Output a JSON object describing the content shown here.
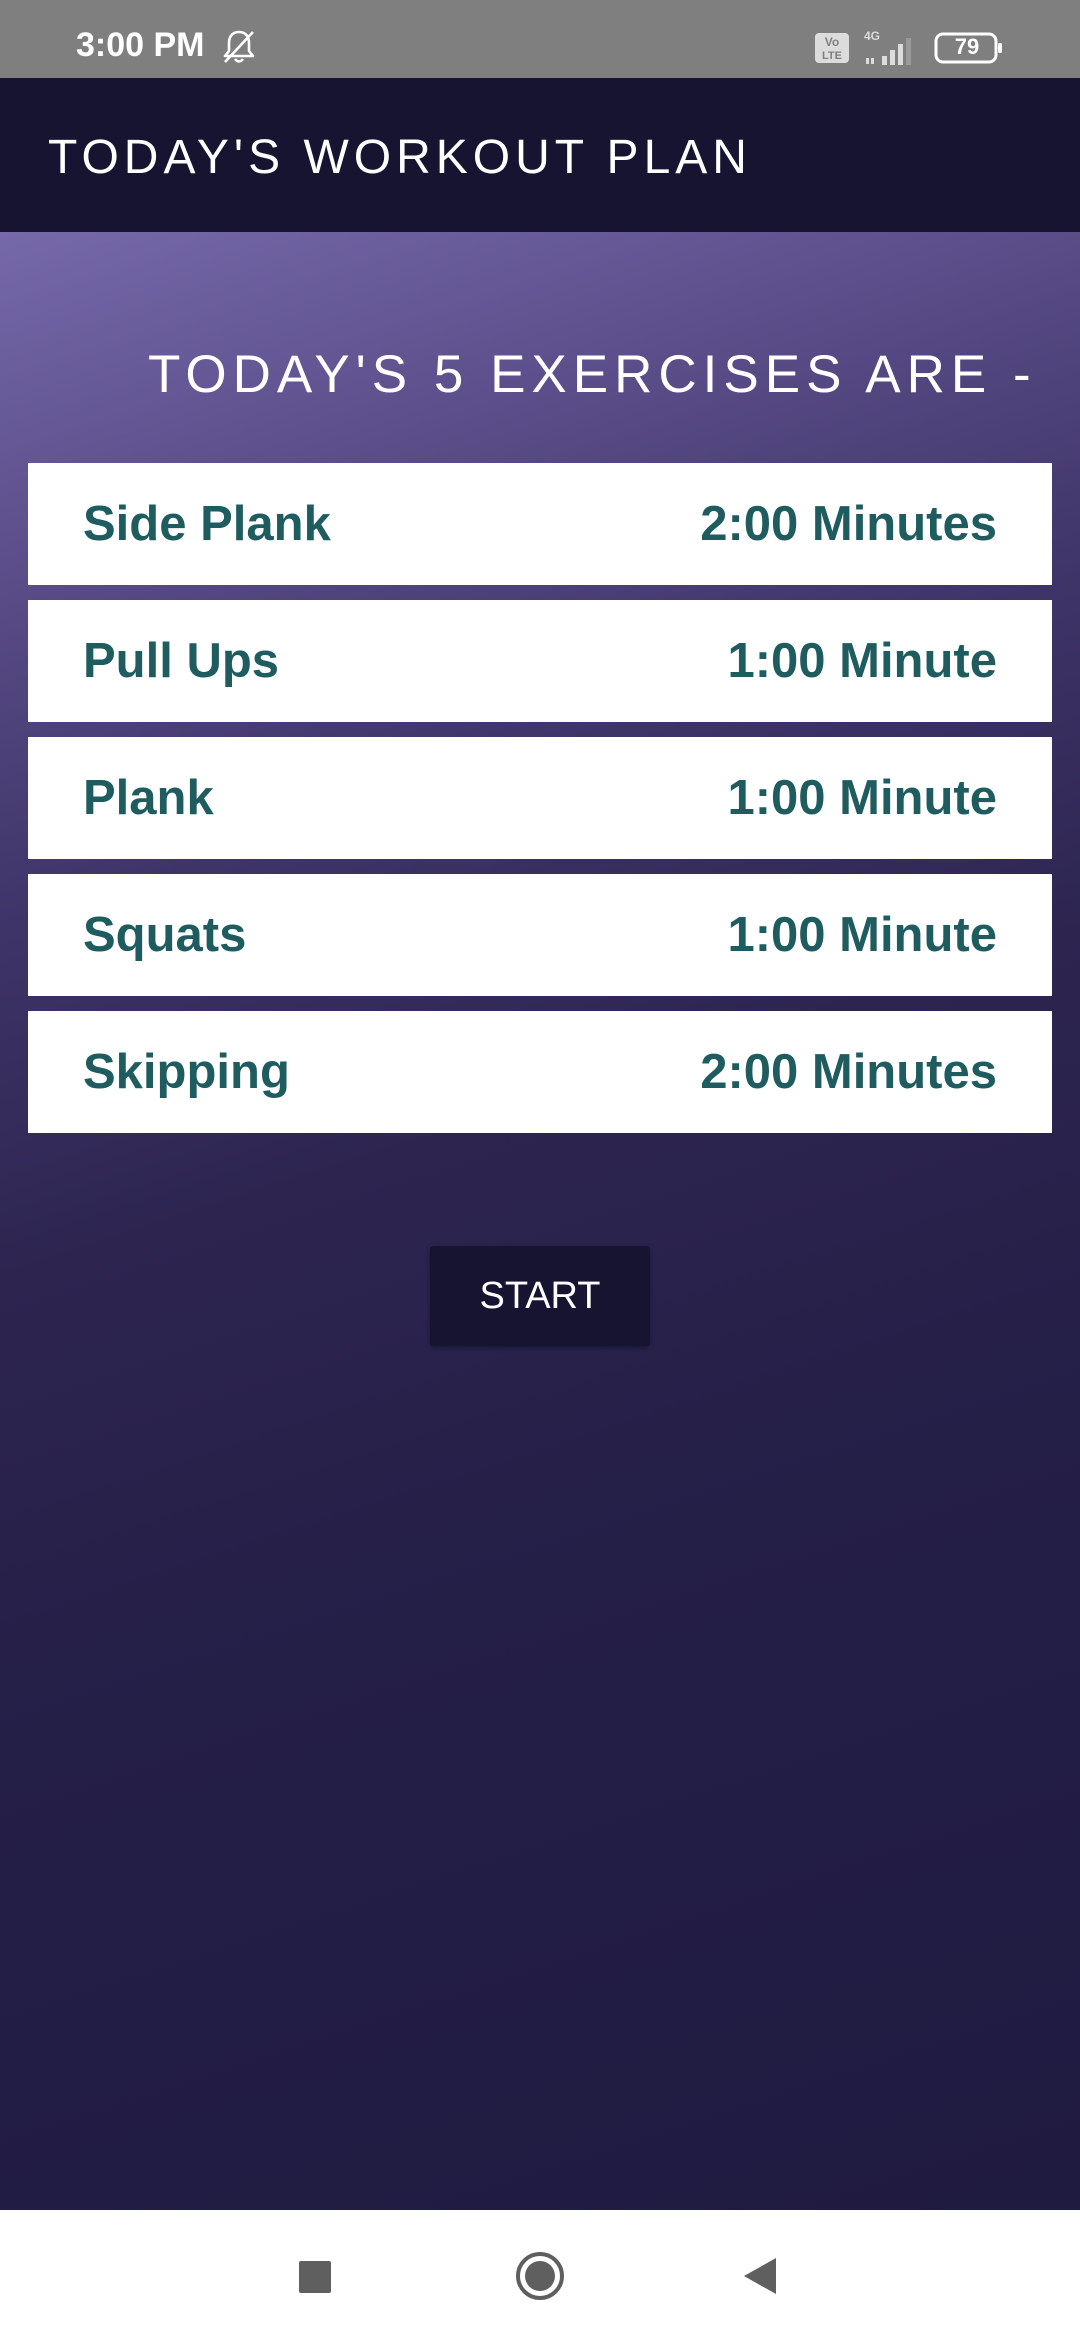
{
  "status_bar": {
    "time": "3:00 PM",
    "battery": "79",
    "icons": [
      "bell-off-icon",
      "volte-icon",
      "signal-4g-icon",
      "battery-icon"
    ]
  },
  "app_bar": {
    "title": "TODAY'S WORKOUT PLAN"
  },
  "main": {
    "subtitle": "TODAY'S 5 EXERCISES ARE -",
    "exercises": [
      {
        "name": "Side Plank",
        "duration": "2:00 Minutes"
      },
      {
        "name": "Pull Ups",
        "duration": "1:00 Minute"
      },
      {
        "name": "Plank",
        "duration": "1:00 Minute"
      },
      {
        "name": "Squats",
        "duration": "1:00 Minute"
      },
      {
        "name": "Skipping",
        "duration": "2:00 Minutes"
      }
    ],
    "start_label": "START"
  },
  "nav_bar": {
    "icons": [
      "recent-apps-icon",
      "home-icon",
      "back-icon"
    ]
  },
  "colors": {
    "app_bar": "#171432",
    "exercise_text": "#1f5c5f",
    "status_bar": "#7f7f7f",
    "gradient_top": "#7669aa",
    "gradient_bottom": "#1f1a40"
  }
}
